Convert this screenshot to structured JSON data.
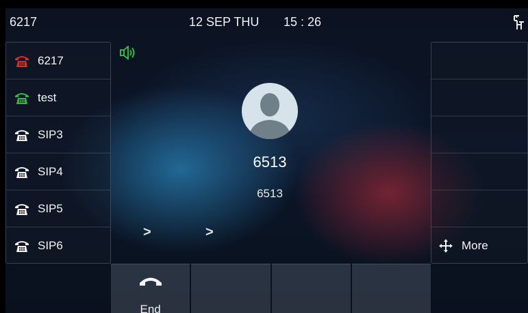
{
  "status_bar": {
    "extension": "6217",
    "date": "12 SEP THU",
    "time": "15 : 26"
  },
  "line_keys": [
    {
      "label": "6217",
      "state": "busy",
      "color": "#e02828"
    },
    {
      "label": "test",
      "state": "registered",
      "color": "#2fb84a"
    },
    {
      "label": "SIP3",
      "state": "idle",
      "color": "#f0f0f0"
    },
    {
      "label": "SIP4",
      "state": "idle",
      "color": "#f0f0f0"
    },
    {
      "label": "SIP5",
      "state": "idle",
      "color": "#f0f0f0"
    },
    {
      "label": "SIP6",
      "state": "idle",
      "color": "#f0f0f0"
    }
  ],
  "call": {
    "name": "6513",
    "number": "6513",
    "audio_mode": "speaker",
    "speaker_color": "#2fb84a"
  },
  "page_arrows": [
    ">",
    ">"
  ],
  "right_panel": {
    "more_label": "More"
  },
  "softkeys": [
    {
      "label": "End",
      "icon": "hangup-icon"
    },
    {
      "label": ""
    },
    {
      "label": ""
    },
    {
      "label": ""
    }
  ]
}
